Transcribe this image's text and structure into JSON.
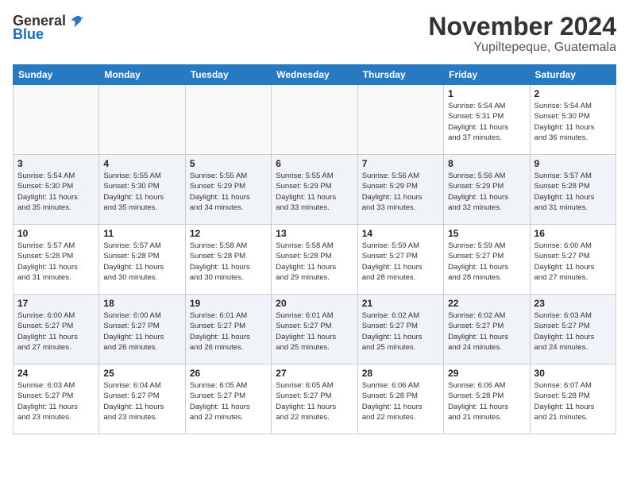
{
  "header": {
    "logo_general": "General",
    "logo_blue": "Blue",
    "month_title": "November 2024",
    "location": "Yupiltepeque, Guatemala"
  },
  "weekdays": [
    "Sunday",
    "Monday",
    "Tuesday",
    "Wednesday",
    "Thursday",
    "Friday",
    "Saturday"
  ],
  "weeks": [
    [
      {
        "day": "",
        "info": ""
      },
      {
        "day": "",
        "info": ""
      },
      {
        "day": "",
        "info": ""
      },
      {
        "day": "",
        "info": ""
      },
      {
        "day": "",
        "info": ""
      },
      {
        "day": "1",
        "info": "Sunrise: 5:54 AM\nSunset: 5:31 PM\nDaylight: 11 hours\nand 37 minutes."
      },
      {
        "day": "2",
        "info": "Sunrise: 5:54 AM\nSunset: 5:30 PM\nDaylight: 11 hours\nand 36 minutes."
      }
    ],
    [
      {
        "day": "3",
        "info": "Sunrise: 5:54 AM\nSunset: 5:30 PM\nDaylight: 11 hours\nand 35 minutes."
      },
      {
        "day": "4",
        "info": "Sunrise: 5:55 AM\nSunset: 5:30 PM\nDaylight: 11 hours\nand 35 minutes."
      },
      {
        "day": "5",
        "info": "Sunrise: 5:55 AM\nSunset: 5:29 PM\nDaylight: 11 hours\nand 34 minutes."
      },
      {
        "day": "6",
        "info": "Sunrise: 5:55 AM\nSunset: 5:29 PM\nDaylight: 11 hours\nand 33 minutes."
      },
      {
        "day": "7",
        "info": "Sunrise: 5:56 AM\nSunset: 5:29 PM\nDaylight: 11 hours\nand 33 minutes."
      },
      {
        "day": "8",
        "info": "Sunrise: 5:56 AM\nSunset: 5:29 PM\nDaylight: 11 hours\nand 32 minutes."
      },
      {
        "day": "9",
        "info": "Sunrise: 5:57 AM\nSunset: 5:28 PM\nDaylight: 11 hours\nand 31 minutes."
      }
    ],
    [
      {
        "day": "10",
        "info": "Sunrise: 5:57 AM\nSunset: 5:28 PM\nDaylight: 11 hours\nand 31 minutes."
      },
      {
        "day": "11",
        "info": "Sunrise: 5:57 AM\nSunset: 5:28 PM\nDaylight: 11 hours\nand 30 minutes."
      },
      {
        "day": "12",
        "info": "Sunrise: 5:58 AM\nSunset: 5:28 PM\nDaylight: 11 hours\nand 30 minutes."
      },
      {
        "day": "13",
        "info": "Sunrise: 5:58 AM\nSunset: 5:28 PM\nDaylight: 11 hours\nand 29 minutes."
      },
      {
        "day": "14",
        "info": "Sunrise: 5:59 AM\nSunset: 5:27 PM\nDaylight: 11 hours\nand 28 minutes."
      },
      {
        "day": "15",
        "info": "Sunrise: 5:59 AM\nSunset: 5:27 PM\nDaylight: 11 hours\nand 28 minutes."
      },
      {
        "day": "16",
        "info": "Sunrise: 6:00 AM\nSunset: 5:27 PM\nDaylight: 11 hours\nand 27 minutes."
      }
    ],
    [
      {
        "day": "17",
        "info": "Sunrise: 6:00 AM\nSunset: 5:27 PM\nDaylight: 11 hours\nand 27 minutes."
      },
      {
        "day": "18",
        "info": "Sunrise: 6:00 AM\nSunset: 5:27 PM\nDaylight: 11 hours\nand 26 minutes."
      },
      {
        "day": "19",
        "info": "Sunrise: 6:01 AM\nSunset: 5:27 PM\nDaylight: 11 hours\nand 26 minutes."
      },
      {
        "day": "20",
        "info": "Sunrise: 6:01 AM\nSunset: 5:27 PM\nDaylight: 11 hours\nand 25 minutes."
      },
      {
        "day": "21",
        "info": "Sunrise: 6:02 AM\nSunset: 5:27 PM\nDaylight: 11 hours\nand 25 minutes."
      },
      {
        "day": "22",
        "info": "Sunrise: 6:02 AM\nSunset: 5:27 PM\nDaylight: 11 hours\nand 24 minutes."
      },
      {
        "day": "23",
        "info": "Sunrise: 6:03 AM\nSunset: 5:27 PM\nDaylight: 11 hours\nand 24 minutes."
      }
    ],
    [
      {
        "day": "24",
        "info": "Sunrise: 6:03 AM\nSunset: 5:27 PM\nDaylight: 11 hours\nand 23 minutes."
      },
      {
        "day": "25",
        "info": "Sunrise: 6:04 AM\nSunset: 5:27 PM\nDaylight: 11 hours\nand 23 minutes."
      },
      {
        "day": "26",
        "info": "Sunrise: 6:05 AM\nSunset: 5:27 PM\nDaylight: 11 hours\nand 22 minutes."
      },
      {
        "day": "27",
        "info": "Sunrise: 6:05 AM\nSunset: 5:27 PM\nDaylight: 11 hours\nand 22 minutes."
      },
      {
        "day": "28",
        "info": "Sunrise: 6:06 AM\nSunset: 5:28 PM\nDaylight: 11 hours\nand 22 minutes."
      },
      {
        "day": "29",
        "info": "Sunrise: 6:06 AM\nSunset: 5:28 PM\nDaylight: 11 hours\nand 21 minutes."
      },
      {
        "day": "30",
        "info": "Sunrise: 6:07 AM\nSunset: 5:28 PM\nDaylight: 11 hours\nand 21 minutes."
      }
    ]
  ]
}
